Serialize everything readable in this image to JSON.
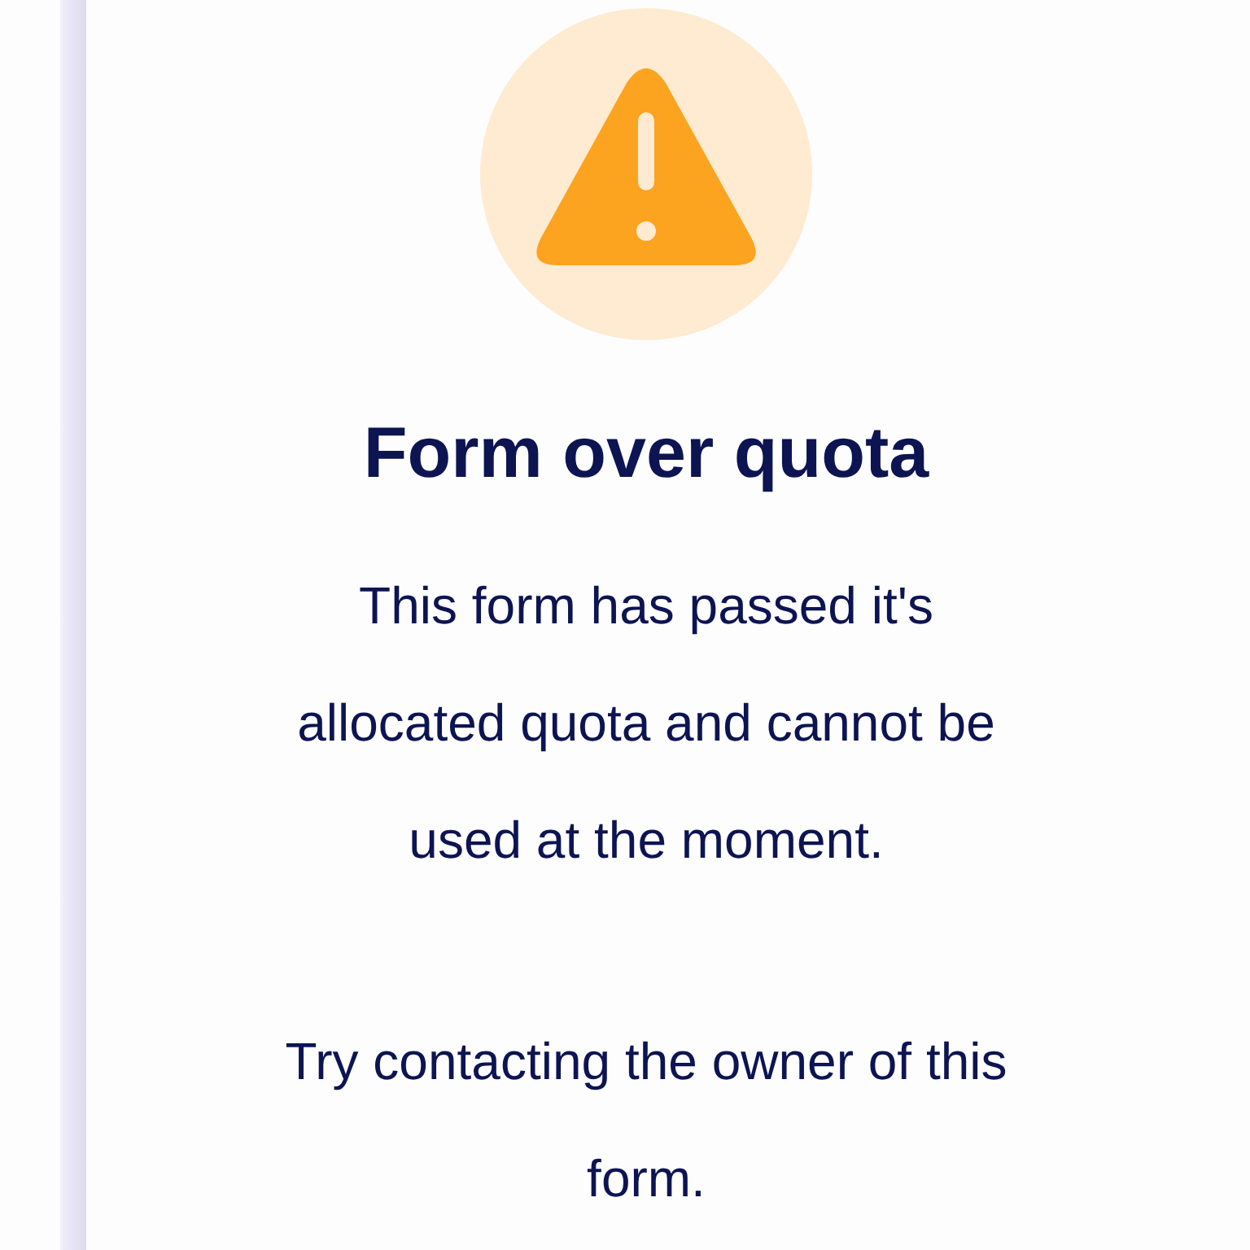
{
  "title": "Form over quota",
  "paragraphs": [
    "This form has passed it's allocated quota and cannot be used at the moment.",
    "Try contacting the owner of this form."
  ]
}
